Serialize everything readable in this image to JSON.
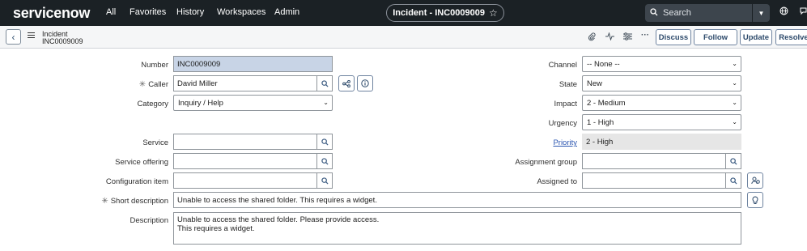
{
  "nav": {
    "logo": "servicenow",
    "items": [
      "All",
      "Favorites",
      "History",
      "Workspaces",
      "Admin"
    ],
    "record_pill": "Incident - INC0009009",
    "search_placeholder": "Search"
  },
  "header": {
    "record_type": "Incident",
    "record_number": "INC0009009",
    "buttons": [
      "Discuss",
      "Follow",
      "Update",
      "Resolve"
    ]
  },
  "form": {
    "number": {
      "label": "Number",
      "value": "INC0009009"
    },
    "caller": {
      "label": "Caller",
      "value": "David Miller"
    },
    "category": {
      "label": "Category",
      "value": "Inquiry / Help"
    },
    "service": {
      "label": "Service",
      "value": ""
    },
    "service_offering": {
      "label": "Service offering",
      "value": ""
    },
    "configuration_item": {
      "label": "Configuration item",
      "value": ""
    },
    "short_description": {
      "label": "Short description",
      "value": "Unable to access the shared folder. This requires a widget."
    },
    "description": {
      "label": "Description",
      "line1": "Unable to access the shared folder. Please provide access.",
      "line2": "This requires a widget."
    },
    "channel": {
      "label": "Channel",
      "value": "-- None --"
    },
    "state": {
      "label": "State",
      "value": "New"
    },
    "impact": {
      "label": "Impact",
      "value": "2 - Medium"
    },
    "urgency": {
      "label": "Urgency",
      "value": "1 - High"
    },
    "priority": {
      "label": "Priority",
      "value": "2 - High"
    },
    "assignment_group": {
      "label": "Assignment group",
      "value": ""
    },
    "assigned_to": {
      "label": "Assigned to",
      "value": ""
    },
    "required_marker": "✳"
  }
}
